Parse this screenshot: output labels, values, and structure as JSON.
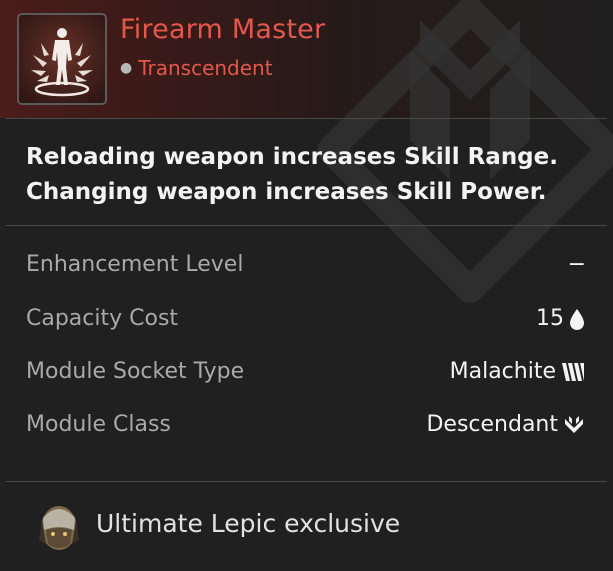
{
  "module": {
    "name": "Firearm Master",
    "tier": "Transcendent",
    "description": [
      "Reloading weapon increases Skill Range.",
      "Changing weapon increases Skill Power."
    ]
  },
  "stats": [
    {
      "label": "Enhancement Level",
      "value": "−",
      "icon": ""
    },
    {
      "label": "Capacity Cost",
      "value": "15",
      "icon": "drop-icon"
    },
    {
      "label": "Module Socket Type",
      "value": "Malachite",
      "icon": "malachite-socket-icon"
    },
    {
      "label": "Module Class",
      "value": "Descendant",
      "icon": "descendant-class-icon"
    }
  ],
  "footer": {
    "text": "Ultimate Lepic exclusive",
    "icon": "lepic-portrait-icon"
  },
  "colors": {
    "title": "#e4584b",
    "header_bg": "#4a1d1a",
    "panel_bg": "#202020"
  }
}
